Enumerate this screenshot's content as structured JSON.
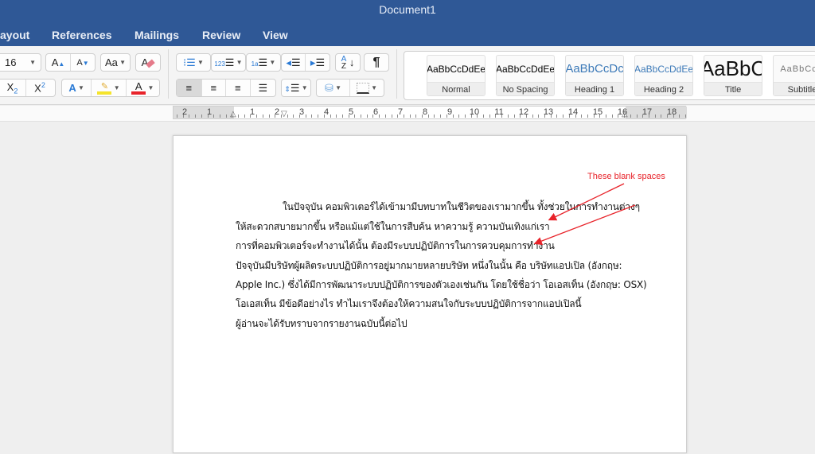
{
  "window": {
    "title": "Document1"
  },
  "tabs": [
    "ayout",
    "References",
    "Mailings",
    "Review",
    "View"
  ],
  "font": {
    "size": "16"
  },
  "style_gallery": [
    {
      "sample": "AaBbCcDdEe",
      "label": "Normal"
    },
    {
      "sample": "AaBbCcDdEe",
      "label": "No Spacing"
    },
    {
      "sample": "AaBbCcDc",
      "label": "Heading 1"
    },
    {
      "sample": "AaBbCcDdEe",
      "label": "Heading 2"
    },
    {
      "sample": "AaBbC",
      "label": "Title"
    },
    {
      "sample": "AaBbCcD",
      "label": "Subtitle"
    }
  ],
  "ruler": {
    "numbers": [
      "2",
      "1",
      "1",
      "2",
      "3",
      "4",
      "5",
      "6",
      "7",
      "8",
      "9",
      "10",
      "11",
      "12",
      "13",
      "14",
      "15",
      "16",
      "17",
      "18"
    ]
  },
  "document": {
    "lines": [
      "ในปัจจุบัน คอมพิวเตอร์ได้เข้ามามีบทบาทในชีวิตของเรามากขึ้น ทั้งช่วยในการทำงานต่างๆ",
      "ให้สะดวกสบายมากขึ้น หรือแม้แต่ใช้ในการสืบค้น หาความรู้ ความบันเทิงแก่เรา",
      "การที่คอมพิวเตอร์จะทำงานได้นั้น ต้องมีระบบปฏิบัติการในการควบคุมการทำงาน",
      "ปัจจุบันมีบริษัทผู้ผลิตระบบปฏิบัติการอยู่มากมายหลายบริษัท หนึ่งในนั้น คือ บริษัทแอปเปิล (อังกฤษ:",
      "Apple Inc.) ซึ่งได้มีการพัฒนาระบบปฏิบัติการของตัวเองเช่นกัน โดยใช้ชื่อว่า โอเอสเท็น (อังกฤษ: OSX)",
      "โอเอสเท็น มีข้อดีอย่างไร ทำไมเราจึงต้องให้ความสนใจกับระบบปฏิบัติการจากแอปเปิลนี้",
      "ผู้อ่านจะได้รับทราบจากรายงานฉบับนี้ต่อไป"
    ],
    "annotation": "These blank spaces"
  },
  "colors": {
    "ribbon_blue": "#2f5896",
    "highlight": "#f5e42c",
    "font_color": "#e8232a",
    "annotation": "#e8232a"
  }
}
